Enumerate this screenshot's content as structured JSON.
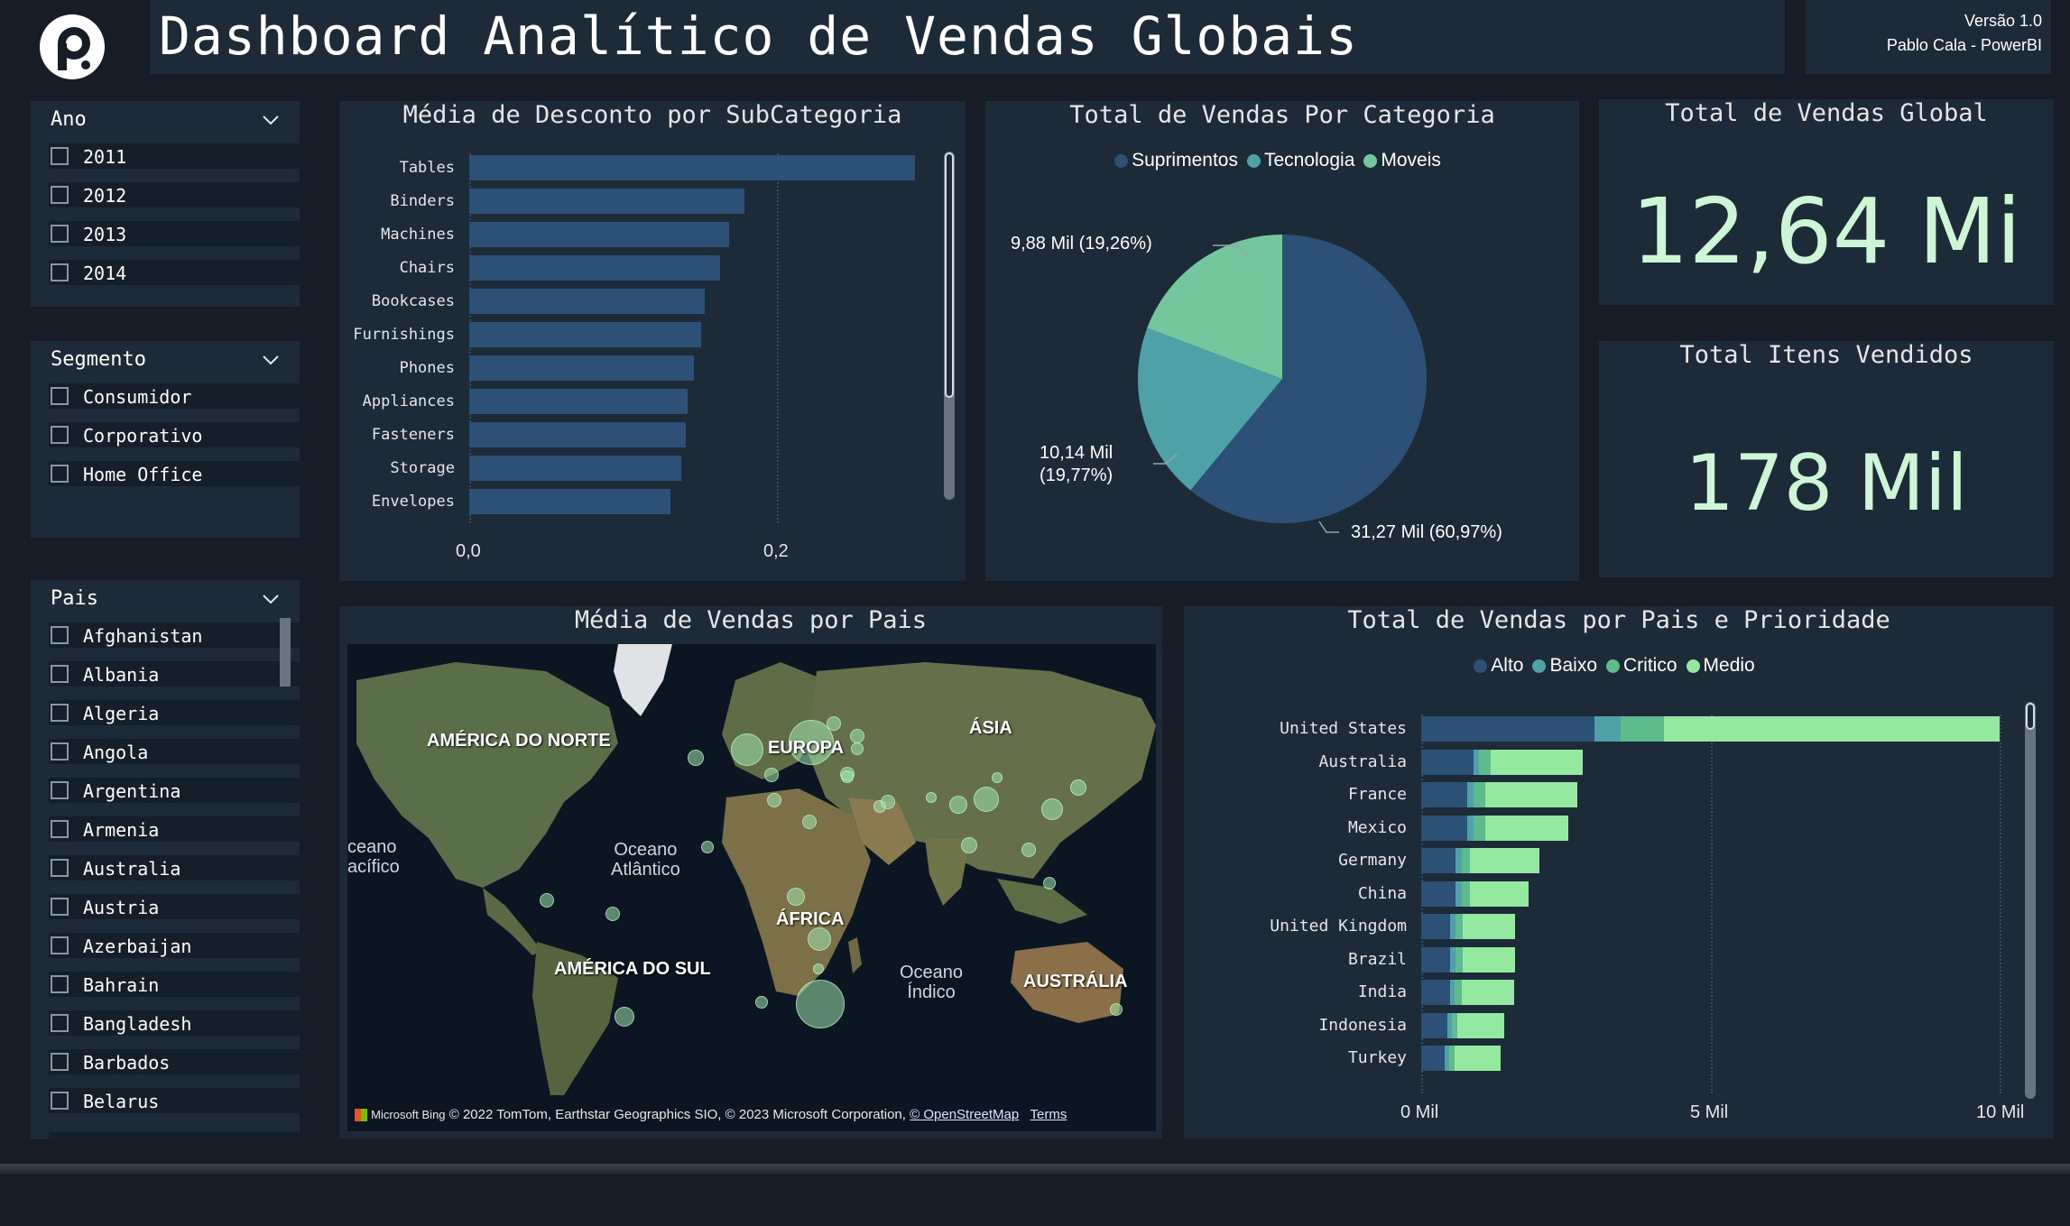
{
  "header": {
    "title": "Dashboard Analítico de Vendas Globais",
    "version": "Versão 1.0",
    "author": "Pablo Cala - PowerBI"
  },
  "slicers": {
    "ano": {
      "title": "Ano",
      "items": [
        "2011",
        "2012",
        "2013",
        "2014"
      ]
    },
    "segmento": {
      "title": "Segmento",
      "items": [
        "Consumidor",
        "Corporativo",
        "Home Office"
      ]
    },
    "pais": {
      "title": "Pais",
      "items": [
        "Afghanistan",
        "Albania",
        "Algeria",
        "Angola",
        "Argentina",
        "Armenia",
        "Australia",
        "Austria",
        "Azerbaijan",
        "Bahrain",
        "Bangladesh",
        "Barbados",
        "Belarus"
      ]
    }
  },
  "discount_chart": {
    "title": "Média de Desconto por SubCategoria",
    "tick_labels": [
      "0,0",
      "0,2"
    ]
  },
  "pie_chart": {
    "title": "Total de Vendas Por Categoria",
    "legend": [
      "Suprimentos",
      "Tecnologia",
      "Moveis"
    ],
    "labels": {
      "moveis": "9,88 Mil (19,26%)",
      "tecnologia_line1": "10,14 Mil",
      "tecnologia_line2": "(19,77%)",
      "suprimentos": "31,27 Mil (60,97%)"
    }
  },
  "kpis": {
    "total_vendas": {
      "title": "Total de Vendas Global",
      "value": "12,64 Mi"
    },
    "total_itens": {
      "title": "Total Itens Vendidos",
      "value": "178 Mil"
    }
  },
  "map": {
    "title": "Média de Vendas por Pais",
    "continents": {
      "north_america": "AMÉRICA DO NORTE",
      "europe": "EUROPA",
      "asia": "ÁSIA",
      "africa": "ÁFRICA",
      "south_america": "AMÉRICA DO SUL",
      "australia": "AUSTRÁLIA"
    },
    "oceans": {
      "pacific_1": "ceano",
      "pacific_2": "acífico",
      "atlantic_1": "Oceano",
      "atlantic_2": "Atlântico",
      "indian_1": "Oceano",
      "indian_2": "Índico"
    },
    "attribution": {
      "brand": "Microsoft Bing",
      "text": "© 2022 TomTom, Earthstar Geographics SIO, © 2023 Microsoft Corporation,",
      "osm": "© OpenStreetMap",
      "terms": "Terms"
    }
  },
  "priority_chart": {
    "title": "Total de Vendas por Pais e Prioridade",
    "legend": [
      "Alto",
      "Baixo",
      "Critico",
      "Medio"
    ],
    "tick_labels": [
      "0 Mil",
      "5 Mil",
      "10 Mil"
    ]
  },
  "colors": {
    "background": "#161d26",
    "panel": "#1d2a38",
    "bar": "#2d5176",
    "suprimentos": "#2d5176",
    "tecnologia": "#4ea1a6",
    "moveis": "#74c69d",
    "alto": "#2d5176",
    "baixo": "#4ea1a6",
    "critico": "#5dbb8e",
    "medio": "#95e8a0",
    "kpi_text": "#cdf5d6"
  },
  "chart_data": [
    {
      "type": "bar",
      "title": "Média de Desconto por SubCategoria",
      "orientation": "horizontal",
      "categories": [
        "Tables",
        "Binders",
        "Machines",
        "Chairs",
        "Bookcases",
        "Furnishings",
        "Phones",
        "Appliances",
        "Fasteners",
        "Storage",
        "Envelopes"
      ],
      "values": [
        0.29,
        0.179,
        0.169,
        0.163,
        0.153,
        0.151,
        0.146,
        0.142,
        0.141,
        0.138,
        0.131
      ],
      "xlim": [
        0,
        0.3
      ],
      "xticks": [
        0.0,
        0.2
      ],
      "grid": true
    },
    {
      "type": "pie",
      "title": "Total de Vendas Por Categoria",
      "categories": [
        "Suprimentos",
        "Tecnologia",
        "Moveis"
      ],
      "values": [
        31.27,
        10.14,
        9.88
      ],
      "percentages": [
        60.97,
        19.77,
        19.26
      ],
      "legend": "top"
    },
    {
      "type": "bar",
      "title": "Total de Vendas por Pais e Prioridade",
      "orientation": "horizontal",
      "stacked": true,
      "categories": [
        "United States",
        "Australia",
        "France",
        "Mexico",
        "Germany",
        "China",
        "United Kingdom",
        "Brazil",
        "India",
        "Indonesia",
        "Turkey"
      ],
      "series": [
        {
          "name": "Alto",
          "values": [
            3.0,
            0.9,
            0.8,
            0.8,
            0.6,
            0.6,
            0.5,
            0.5,
            0.5,
            0.45,
            0.4
          ]
        },
        {
          "name": "Baixo",
          "values": [
            0.45,
            0.1,
            0.1,
            0.1,
            0.1,
            0.1,
            0.1,
            0.1,
            0.08,
            0.08,
            0.08
          ]
        },
        {
          "name": "Critico",
          "values": [
            0.75,
            0.2,
            0.2,
            0.2,
            0.15,
            0.15,
            0.12,
            0.12,
            0.12,
            0.1,
            0.1
          ]
        },
        {
          "name": "Medio",
          "values": [
            5.8,
            1.6,
            1.6,
            1.45,
            1.2,
            1.0,
            0.9,
            0.9,
            0.9,
            0.8,
            0.8
          ]
        }
      ],
      "xlim": [
        0,
        10
      ],
      "xticks": [
        0,
        5,
        10
      ],
      "legend": "top",
      "grid": true
    }
  ]
}
